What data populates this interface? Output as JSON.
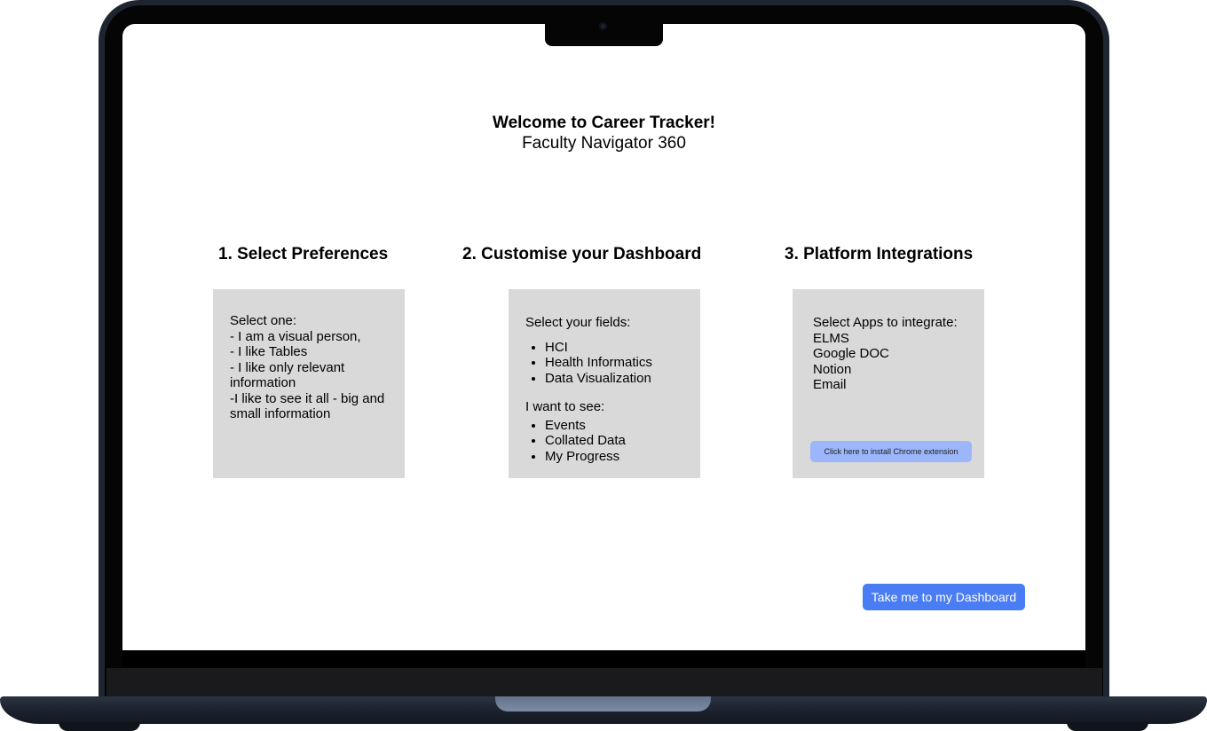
{
  "header": {
    "welcome": "Welcome to Career Tracker!",
    "subtitle": "Faculty Navigator 360"
  },
  "steps": [
    {
      "title": "1. Select Preferences",
      "lines": [
        "Select one:",
        "- I am a visual person,",
        "- I like Tables",
        "- I like only relevant information",
        "-I like to see it all - big and small information"
      ]
    },
    {
      "title": "2. Customise your Dashboard",
      "fields_heading": "Select your fields:",
      "fields": [
        "HCI",
        "Health Informatics",
        "Data Visualization"
      ],
      "see_heading": "I want to see:",
      "see": [
        "Events",
        "Collated Data",
        "My Progress"
      ]
    },
    {
      "title": "3. Platform Integrations",
      "apps_heading": "Select Apps to integrate:",
      "apps": [
        "ELMS",
        "Google DOC",
        "Notion",
        "Email"
      ],
      "chrome_button": "Click here to install Chrome extension"
    }
  ],
  "dashboard_button": "Take me to my Dashboard",
  "colors": {
    "card_bg": "#d9d9d9",
    "primary_button": "#4a7cf3",
    "secondary_button": "#9bb6fb",
    "laptop_frame": "#1f2530"
  }
}
